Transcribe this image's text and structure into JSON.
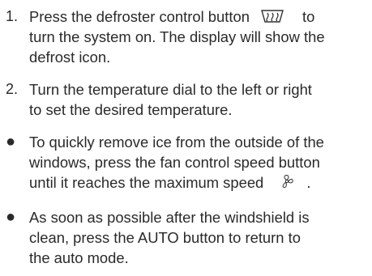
{
  "steps": [
    {
      "marker": "1.",
      "lines": {
        "l1_before": "Press the defroster control button",
        "l1_after": "to",
        "l2": "turn the system on. The display will show the",
        "l3": "defrost icon."
      },
      "icon": "rear-defroster-icon"
    },
    {
      "marker": "2.",
      "lines": {
        "l1": "Turn the temperature dial to the left or right",
        "l2": "to set the desired temperature."
      }
    }
  ],
  "bullets": [
    {
      "marker": "●",
      "lines": {
        "l1": "To quickly remove ice from the outside of the",
        "l2": "windows, press the fan control speed button",
        "l3_before": "until it reaches the maximum speed",
        "l3_after": "."
      },
      "icon": "fan-icon"
    },
    {
      "marker": "●",
      "lines": {
        "l1": "As soon as possible after the windshield is",
        "l2": "clean, press the AUTO button to return to",
        "l3": "the auto mode."
      }
    }
  ]
}
